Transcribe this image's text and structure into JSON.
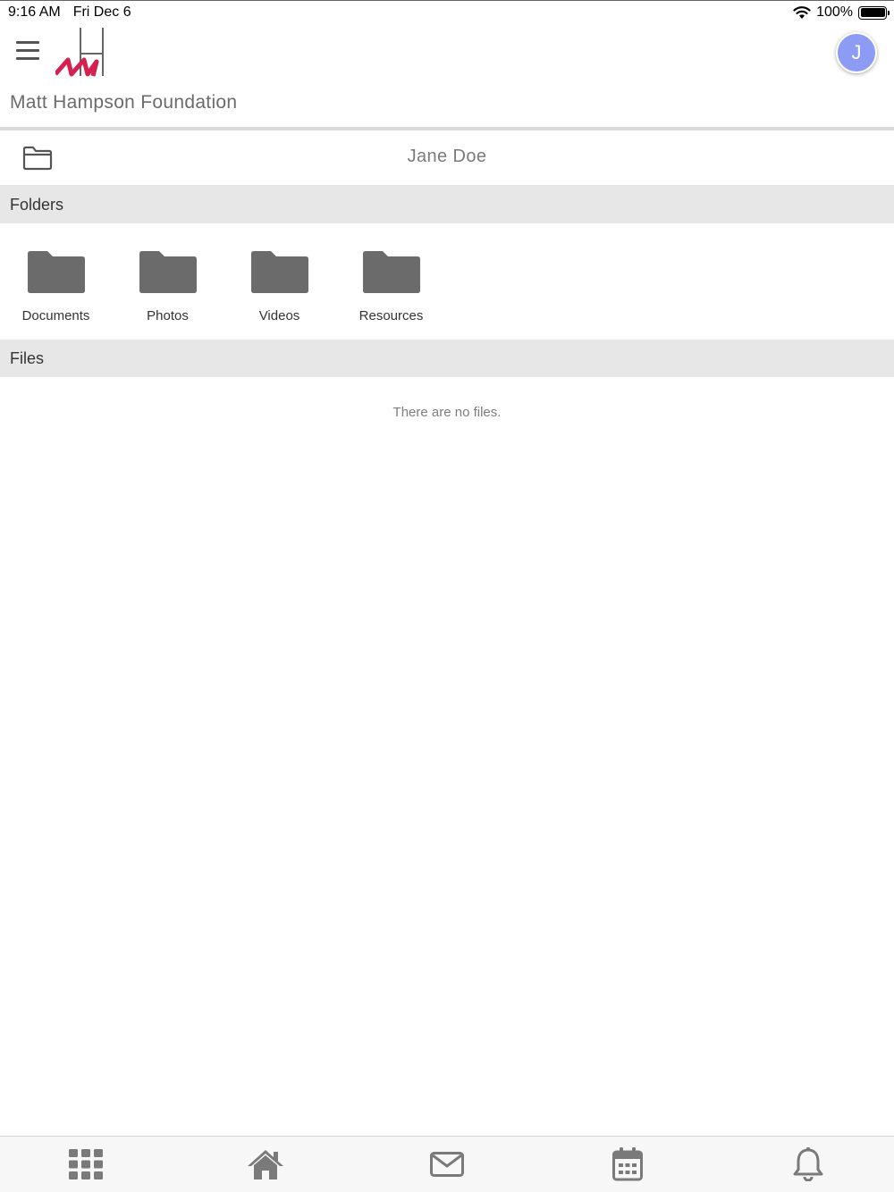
{
  "status_bar": {
    "time": "9:16 AM",
    "date": "Fri Dec 6",
    "battery_percent": "100%",
    "battery_level": 1.0,
    "icons": [
      "wifi-icon",
      "battery-icon"
    ]
  },
  "header": {
    "org_name": "Matt Hampson Foundation",
    "avatar_initial": "J",
    "avatar_color": "#8c9cf5",
    "logo_accent_color": "#d6204f"
  },
  "breadcrumb": {
    "title": "Jane Doe",
    "icon": "folder-outline-icon"
  },
  "folders_section": {
    "heading": "Folders",
    "items": [
      {
        "label": "Documents",
        "icon": "folder-icon"
      },
      {
        "label": "Photos",
        "icon": "folder-icon"
      },
      {
        "label": "Videos",
        "icon": "folder-icon"
      },
      {
        "label": "Resources",
        "icon": "folder-icon"
      }
    ]
  },
  "files_section": {
    "heading": "Files",
    "empty_message": "There are no files."
  },
  "tab_bar": {
    "items": [
      {
        "icon": "apps-grid-icon"
      },
      {
        "icon": "home-icon"
      },
      {
        "icon": "mail-icon"
      },
      {
        "icon": "calendar-icon"
      },
      {
        "icon": "bell-icon"
      }
    ],
    "icon_color": "#7a7a7a"
  }
}
